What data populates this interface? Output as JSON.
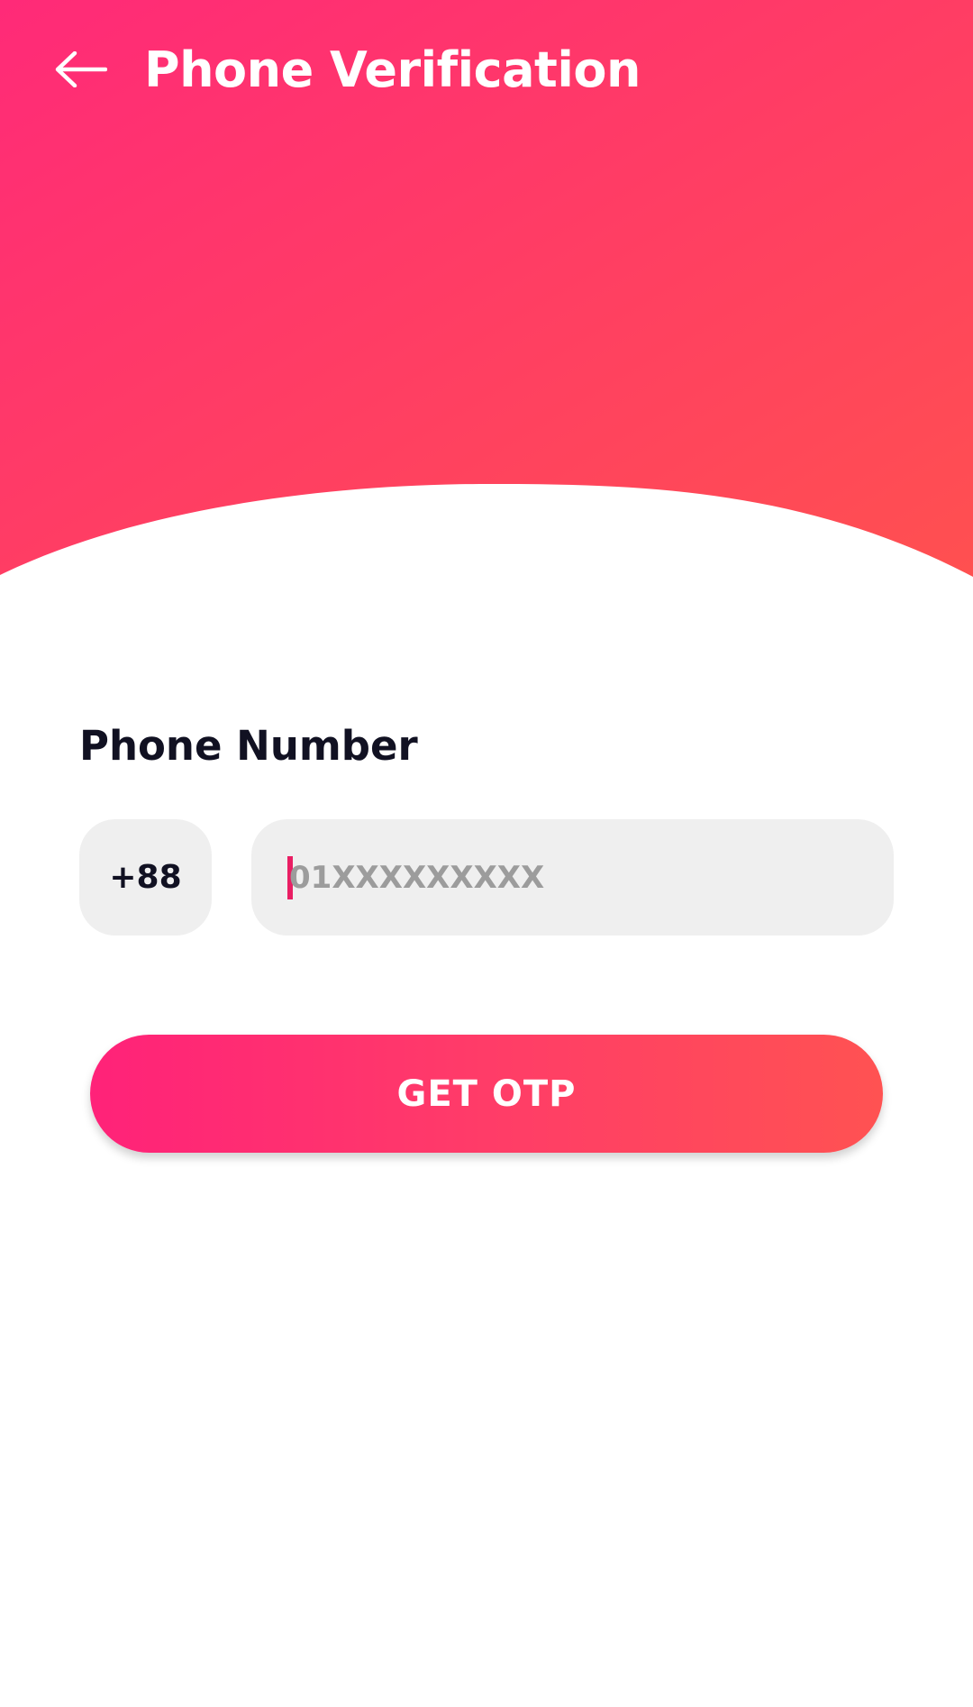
{
  "header": {
    "title": "Phone Verification",
    "back_icon": "arrow-left-icon",
    "gradient_start": "#ff2a78",
    "gradient_end": "#ff5050"
  },
  "form": {
    "label": "Phone Number",
    "country_code": "+88",
    "phone_placeholder": "01XXXXXXXXX",
    "phone_value": "",
    "caret_color": "#e91e63"
  },
  "actions": {
    "get_otp_label": "GET OTP",
    "button_gradient_start": "#ff2279",
    "button_gradient_end": "#ff5252"
  }
}
